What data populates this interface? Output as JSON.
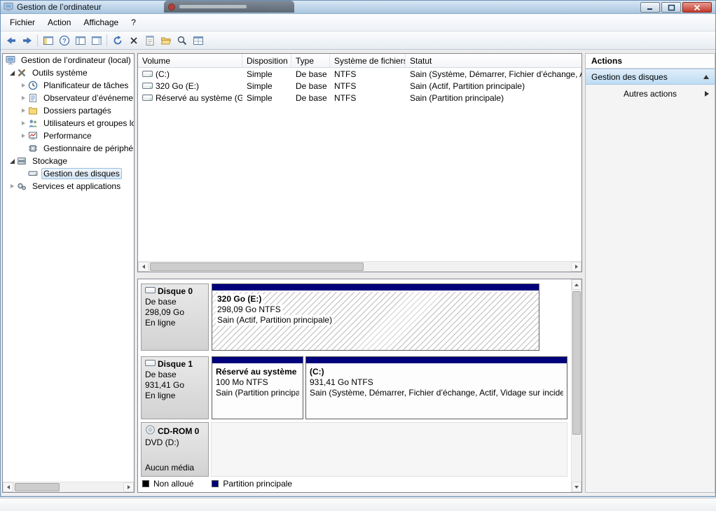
{
  "window": {
    "title": "Gestion de l’ordinateur"
  },
  "menubar": {
    "items": [
      "Fichier",
      "Action",
      "Affichage",
      "?"
    ]
  },
  "toolbar": {
    "icons": [
      "back",
      "forward",
      "show-console-tree",
      "help",
      "show-hide-pane",
      "show-action-pane",
      "refresh",
      "delete",
      "properties",
      "open-folder",
      "search",
      "new-window"
    ]
  },
  "tree": {
    "items": [
      {
        "label": "Gestion de l’ordinateur (local)"
      },
      {
        "label": "Outils système"
      },
      {
        "label": "Planificateur de tâches"
      },
      {
        "label": "Observateur d’événements"
      },
      {
        "label": "Dossiers partagés"
      },
      {
        "label": "Utilisateurs et groupes locaux"
      },
      {
        "label": "Performance"
      },
      {
        "label": "Gestionnaire de périphériques"
      },
      {
        "label": "Stockage"
      },
      {
        "label": "Gestion des disques"
      },
      {
        "label": "Services et applications"
      }
    ]
  },
  "volume_list": {
    "columns": [
      "Volume",
      "Disposition",
      "Type",
      "Système de fichiers",
      "Statut"
    ],
    "rows": [
      [
        "(C:)",
        "Simple",
        "De base",
        "NTFS",
        "Sain (Système, Démarrer, Fichier d’échange, Actif, Vidage sur incident, Partition principale)"
      ],
      [
        "320 Go (E:)",
        "Simple",
        "De base",
        "NTFS",
        "Sain (Actif, Partition principale)"
      ],
      [
        "Réservé au système (G:)",
        "Simple",
        "De base",
        "NTFS",
        "Sain (Partition principale)"
      ]
    ]
  },
  "disk_view": {
    "disks": [
      {
        "name": "Disque 0",
        "kind": "De base",
        "size": "298,09 Go",
        "status": "En ligne",
        "partitions": [
          {
            "label": "320 Go  (E:)",
            "detail": "298,09 Go NTFS",
            "status": "Sain (Actif, Partition principale)"
          }
        ]
      },
      {
        "name": "Disque 1",
        "kind": "De base",
        "size": "931,41 Go",
        "status": "En ligne",
        "partitions": [
          {
            "label": "Réservé au système",
            "detail": "100 Mo NTFS",
            "status": "Sain (Partition principale)"
          },
          {
            "label": "(C:)",
            "detail": "931,41 Go NTFS",
            "status": "Sain (Système, Démarrer, Fichier d’échange, Actif, Vidage sur incident, Partition principale)"
          }
        ]
      },
      {
        "name": "CD-ROM 0",
        "kind": "DVD (D:)",
        "size": "",
        "status": "Aucun média",
        "partitions": []
      }
    ],
    "legend": [
      {
        "label": "Non alloué",
        "color": "#000000"
      },
      {
        "label": "Partition principale",
        "color": "#00007b"
      }
    ]
  },
  "actions": {
    "title": "Actions",
    "section": "Gestion des disques",
    "more": "Autres actions"
  },
  "colors": {
    "partition_primary": "#00007b",
    "titlebar": "#a9c6e0"
  }
}
